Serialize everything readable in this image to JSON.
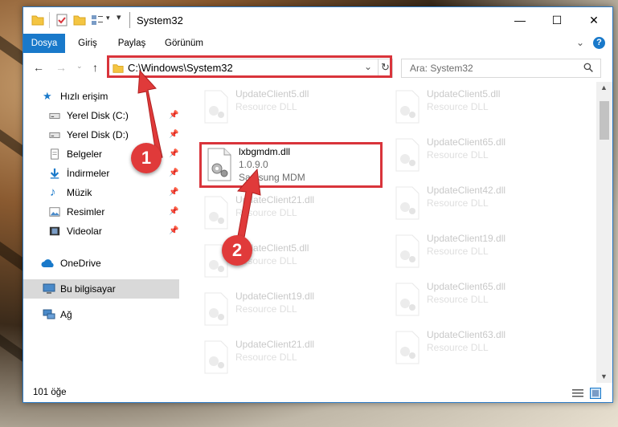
{
  "window": {
    "title": "System32",
    "buttons": {
      "minimize": "—",
      "maximize": "☐",
      "close": "✕"
    }
  },
  "ribbon": {
    "tabs": [
      "Dosya",
      "Giriş",
      "Paylaş",
      "Görünüm"
    ]
  },
  "address": {
    "path": "C:\\Windows\\System32",
    "search_placeholder": "Ara: System32"
  },
  "nav": {
    "quick_access": "Hızlı erişim",
    "items": [
      {
        "label": "Yerel Disk (C:)",
        "icon": "drive-icon",
        "pinned": true
      },
      {
        "label": "Yerel Disk (D:)",
        "icon": "drive-icon",
        "pinned": true
      },
      {
        "label": "Belgeler",
        "icon": "documents-icon",
        "pinned": true
      },
      {
        "label": "İndirmeler",
        "icon": "download-icon",
        "pinned": true
      },
      {
        "label": "Müzik",
        "icon": "music-icon",
        "pinned": true
      },
      {
        "label": "Resimler",
        "icon": "pictures-icon",
        "pinned": true
      },
      {
        "label": "Videolar",
        "icon": "video-icon",
        "pinned": true
      }
    ],
    "onedrive": "OneDrive",
    "this_pc": "Bu bilgisayar",
    "network": "Ağ"
  },
  "files": {
    "highlighted": {
      "name": "lxbgmdm.dll",
      "version": "1.0.9.0",
      "company": "Samsung MDM"
    },
    "left_column": [
      {
        "name": "UpdateClient5.dll",
        "type": "Resource DLL"
      },
      {
        "name": "UpdateClient21.dll",
        "type": "Resource DLL"
      },
      {
        "name": "UpdateClient5.dll",
        "type": "Resource DLL"
      },
      {
        "name": "UpdateClient19.dll",
        "type": "Resource DLL"
      },
      {
        "name": "UpdateClient21.dll",
        "type": "Resource DLL"
      }
    ],
    "right_column": [
      {
        "name": "UpdateClient5.dll",
        "type": "Resource DLL"
      },
      {
        "name": "UpdateClient65.dll",
        "type": "Resource DLL"
      },
      {
        "name": "UpdateClient42.dll",
        "type": "Resource DLL"
      },
      {
        "name": "UpdateClient19.dll",
        "type": "Resource DLL"
      },
      {
        "name": "UpdateClient65.dll",
        "type": "Resource DLL"
      },
      {
        "name": "UpdateClient63.dll",
        "type": "Resource DLL"
      }
    ]
  },
  "status": {
    "count": "101 öğe"
  },
  "callouts": [
    "1",
    "2"
  ],
  "colors": {
    "accent": "#1979ca",
    "highlight": "#d9343b",
    "callout": "#e03a3a"
  }
}
